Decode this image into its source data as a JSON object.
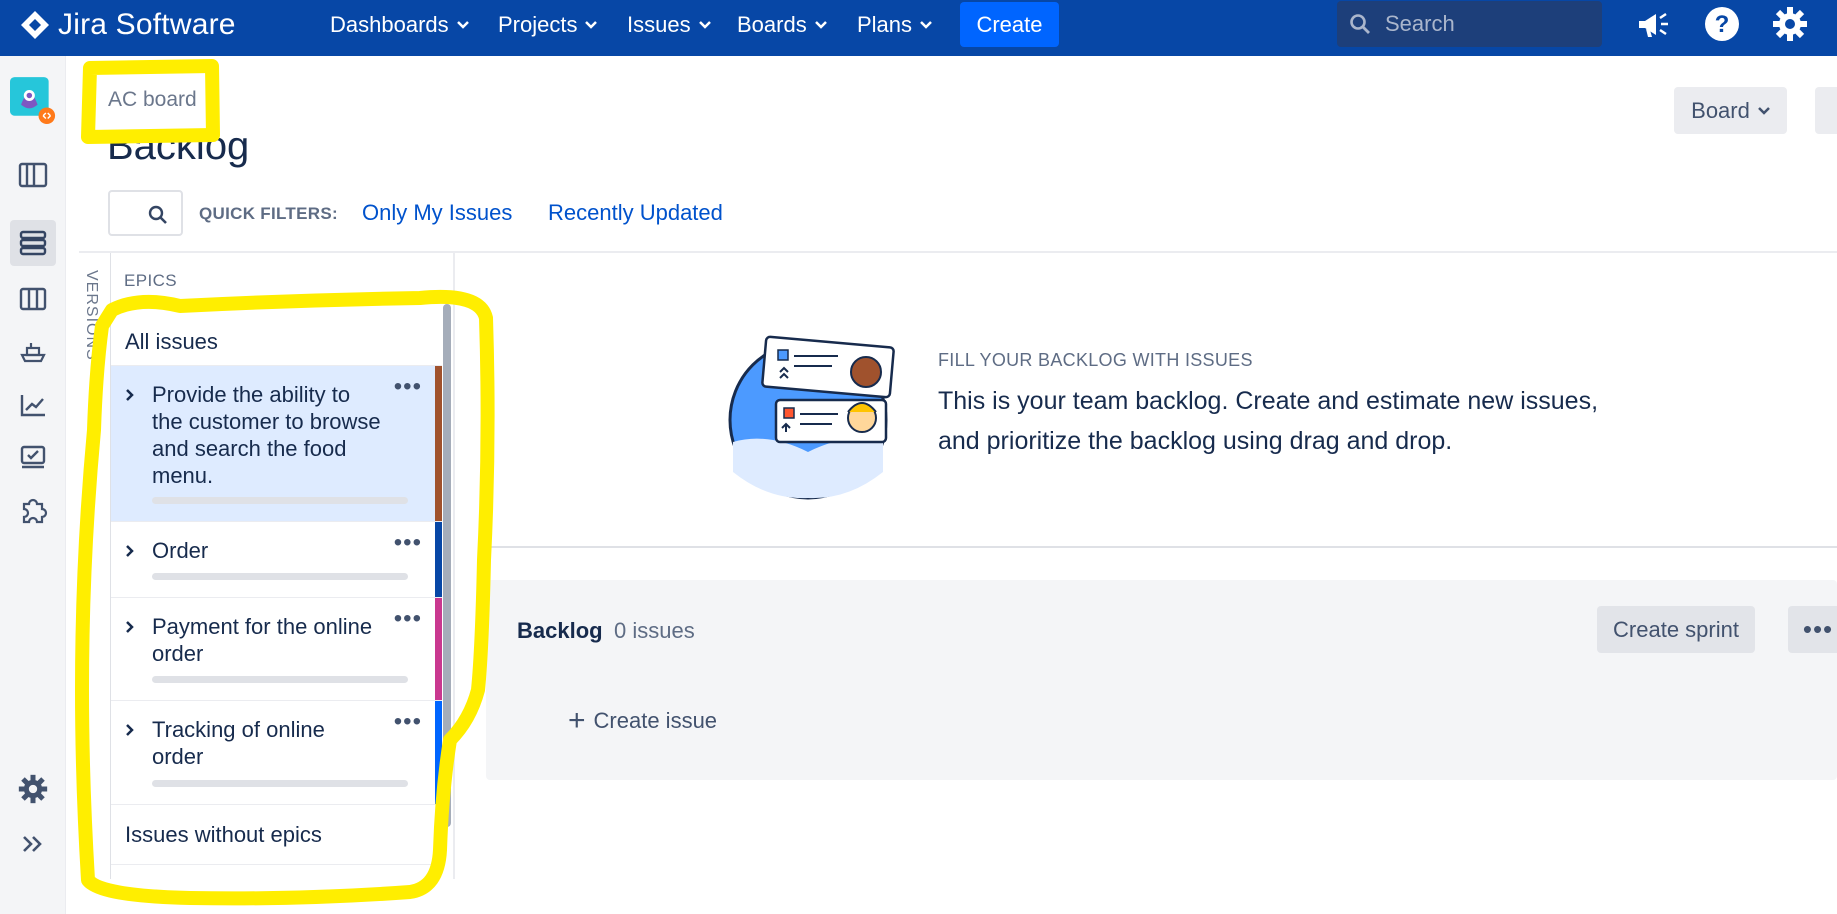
{
  "topnav": {
    "product": "Jira Software",
    "items": [
      {
        "label": "Dashboards"
      },
      {
        "label": "Projects"
      },
      {
        "label": "Issues"
      },
      {
        "label": "Boards"
      },
      {
        "label": "Plans"
      }
    ],
    "create_label": "Create",
    "search_placeholder": "Search"
  },
  "header": {
    "breadcrumb": "AC board",
    "title": "Backlog",
    "board_button": "Board"
  },
  "quick_filters": {
    "label": "QUICK FILTERS:",
    "filters": [
      "Only My Issues",
      "Recently Updated"
    ]
  },
  "versions_tab": "VERSIONS",
  "epics_panel": {
    "heading": "EPICS",
    "all_issues": "All issues",
    "epics": [
      {
        "title": "Provide the ability to the customer to browse and search the food menu.",
        "color": "#a0522d",
        "selected": true
      },
      {
        "title": "Order",
        "color": "#0747a6",
        "selected": false
      },
      {
        "title": "Payment for the online order",
        "color": "#c9388f",
        "selected": false
      },
      {
        "title": "Tracking of online order",
        "color": "#0065ff",
        "selected": false
      }
    ],
    "without_epics": "Issues without epics"
  },
  "empty_state": {
    "heading": "FILL YOUR BACKLOG WITH ISSUES",
    "text": "This is your team backlog. Create and estimate new issues, and prioritize the backlog using drag and drop."
  },
  "backlog": {
    "title": "Backlog",
    "count": "0 issues",
    "create_sprint": "Create sprint",
    "more": "•••",
    "create_issue": "Create issue"
  },
  "colors": {
    "nav_bg": "#0747a6",
    "create_btn": "#0065ff",
    "highlight": "#ffee00",
    "link": "#0052cc"
  }
}
